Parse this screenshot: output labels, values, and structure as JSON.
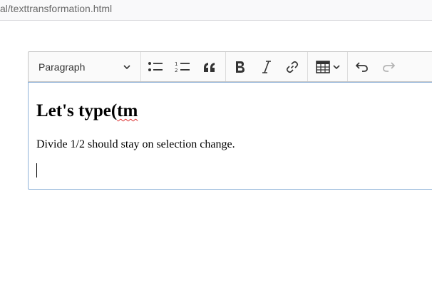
{
  "browser": {
    "url_fragment": "al/texttransformation.html"
  },
  "toolbar": {
    "heading_select": "Paragraph",
    "icons": [
      "chevron-down-icon",
      "bulleted-list-icon",
      "numbered-list-icon",
      "block-quote-icon",
      "bold-icon",
      "italic-icon",
      "link-icon",
      "table-icon",
      "undo-icon",
      "redo-icon"
    ]
  },
  "content": {
    "heading_prefix": "Let's type(",
    "heading_misspelled": "tm",
    "paragraph": "Divide 1/2 should stay on selection change."
  },
  "colors": {
    "focus_border": "#8fb3d9",
    "toolbar_bg": "#fafafa",
    "spellcheck": "#d33"
  }
}
